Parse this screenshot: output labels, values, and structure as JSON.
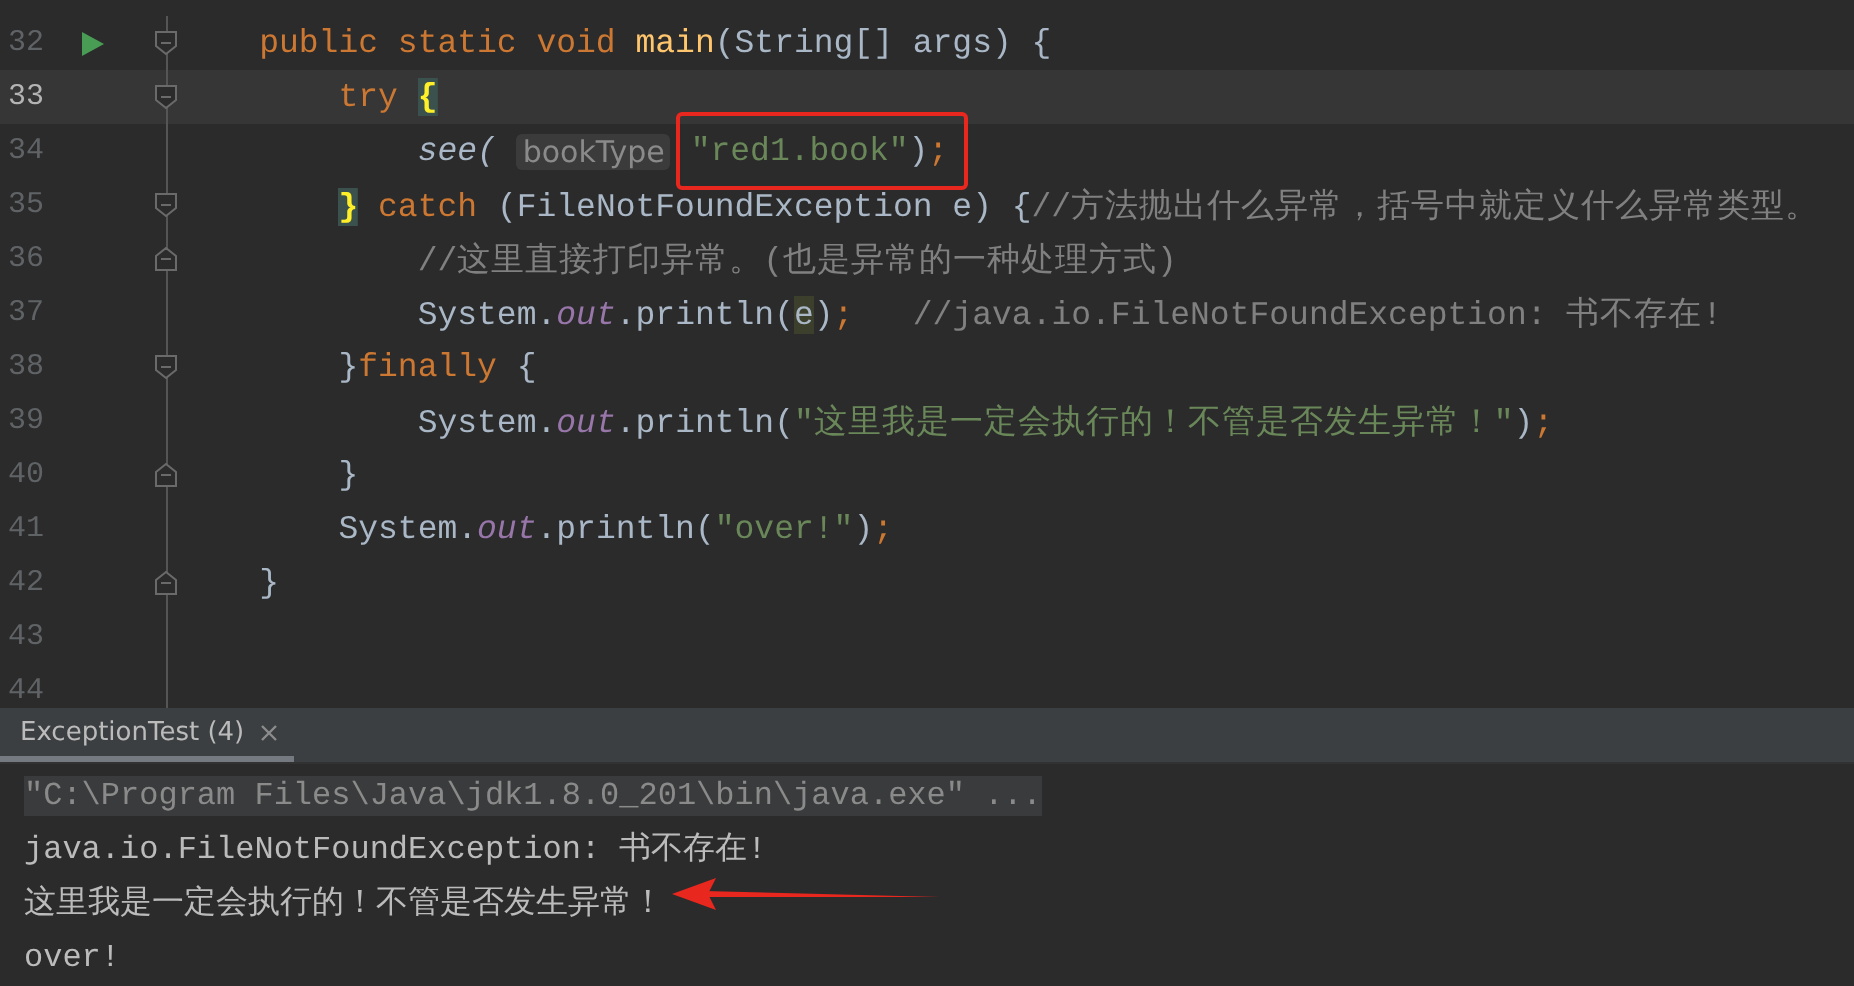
{
  "editor": {
    "lines": [
      {
        "number": "32",
        "run": true,
        "fold_start": true,
        "fold_end": false,
        "current": false,
        "marked": false,
        "tokens": [
          {
            "kind": "kw",
            "text": "    public static void "
          },
          {
            "kind": "method",
            "text": "main"
          },
          {
            "kind": "plain",
            "text": "(String[] args) {"
          }
        ]
      },
      {
        "number": "33",
        "run": false,
        "fold_start": true,
        "fold_end": false,
        "current": true,
        "marked": false,
        "tokens": [
          {
            "kind": "kw",
            "text": "        try "
          },
          {
            "kind": "brace",
            "text": "{"
          }
        ]
      },
      {
        "number": "34",
        "run": false,
        "fold_start": false,
        "fold_end": false,
        "current": false,
        "marked": true,
        "tokens": [
          {
            "kind": "call",
            "text": "            see( "
          },
          {
            "kind": "hint",
            "text": "bookType"
          },
          {
            "kind": "string",
            "text": "\"red1.book\""
          },
          {
            "kind": "plain",
            "text": ")"
          },
          {
            "kind": "kw",
            "text": ";"
          }
        ]
      },
      {
        "number": "35",
        "run": false,
        "fold_start": true,
        "fold_end": false,
        "current": false,
        "marked": false,
        "tokens": [
          {
            "kind": "brace",
            "text": "        }"
          },
          {
            "kind": "kw",
            "text": " catch "
          },
          {
            "kind": "plain",
            "text": "(FileNotFoundException e) {"
          },
          {
            "kind": "comment",
            "text": "//方法抛出什么异常，括号中就定义什么异常类型。"
          }
        ]
      },
      {
        "number": "36",
        "run": false,
        "fold_start": false,
        "fold_end": true,
        "current": false,
        "marked": false,
        "tokens": [
          {
            "kind": "comment",
            "text": "            //这里直接打印异常。(也是异常的一种处理方式)"
          }
        ]
      },
      {
        "number": "37",
        "run": false,
        "fold_start": false,
        "fold_end": false,
        "current": false,
        "marked": false,
        "tokens": [
          {
            "kind": "plain",
            "text": "            System."
          },
          {
            "kind": "static",
            "text": "out"
          },
          {
            "kind": "plain",
            "text": ".println("
          },
          {
            "kind": "var",
            "text": "e"
          },
          {
            "kind": "plain",
            "text": ")"
          },
          {
            "kind": "kw",
            "text": ";"
          },
          {
            "kind": "comment",
            "text": "   //java.io.FileNotFoundException: 书不存在!"
          }
        ]
      },
      {
        "number": "38",
        "run": false,
        "fold_start": true,
        "fold_end": false,
        "current": false,
        "marked": false,
        "tokens": [
          {
            "kind": "plain",
            "text": "        }"
          },
          {
            "kind": "kw",
            "text": "finally "
          },
          {
            "kind": "plain",
            "text": "{"
          }
        ]
      },
      {
        "number": "39",
        "run": false,
        "fold_start": false,
        "fold_end": false,
        "current": false,
        "marked": false,
        "tokens": [
          {
            "kind": "plain",
            "text": "            System."
          },
          {
            "kind": "static",
            "text": "out"
          },
          {
            "kind": "plain",
            "text": ".println("
          },
          {
            "kind": "string",
            "text": "\"这里我是一定会执行的！不管是否发生异常！\""
          },
          {
            "kind": "plain",
            "text": ")"
          },
          {
            "kind": "kw",
            "text": ";"
          }
        ]
      },
      {
        "number": "40",
        "run": false,
        "fold_start": false,
        "fold_end": true,
        "current": false,
        "marked": false,
        "tokens": [
          {
            "kind": "plain",
            "text": "        }"
          }
        ]
      },
      {
        "number": "41",
        "run": false,
        "fold_start": false,
        "fold_end": false,
        "current": false,
        "marked": false,
        "tokens": [
          {
            "kind": "plain",
            "text": "        System."
          },
          {
            "kind": "static",
            "text": "out"
          },
          {
            "kind": "plain",
            "text": ".println("
          },
          {
            "kind": "string",
            "text": "\"over!\""
          },
          {
            "kind": "plain",
            "text": ")"
          },
          {
            "kind": "kw",
            "text": ";"
          }
        ]
      },
      {
        "number": "42",
        "run": false,
        "fold_start": false,
        "fold_end": true,
        "current": false,
        "marked": false,
        "tokens": [
          {
            "kind": "plain",
            "text": "    }"
          }
        ]
      },
      {
        "number": "43",
        "run": false,
        "fold_start": false,
        "fold_end": false,
        "current": false,
        "marked": false
      },
      {
        "number": "44",
        "run": false,
        "fold_start": false,
        "fold_end": false,
        "current": false,
        "marked": false
      }
    ]
  },
  "console": {
    "tabs": [
      {
        "label": "ExceptionTest (4)",
        "selected": true
      }
    ],
    "lines": [
      {
        "kind": "command",
        "text": "\"C:\\Program Files\\Java\\jdk1.8.0_201\\bin\\java.exe\" ..."
      },
      {
        "kind": "output",
        "text": "java.io.FileNotFoundException: 书不存在!"
      },
      {
        "kind": "output",
        "text": "这里我是一定会执行的！不管是否发生异常！"
      },
      {
        "kind": "output",
        "text": "over!"
      }
    ]
  }
}
